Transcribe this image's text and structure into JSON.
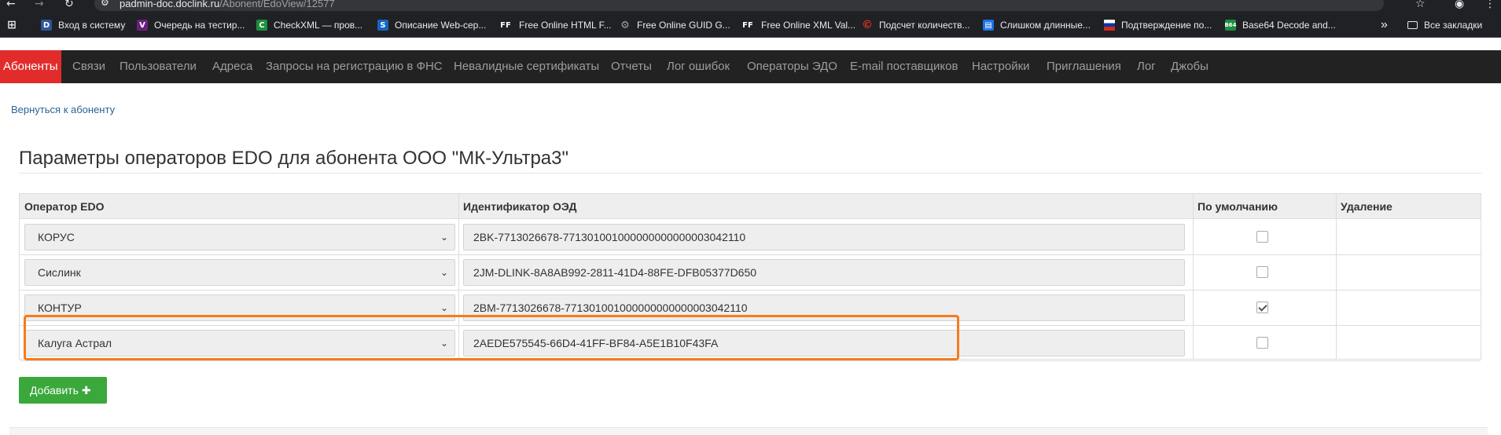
{
  "browser": {
    "url_host": "padmin-doc.doclink.ru",
    "url_path": "/Abonent/EdoView/12577",
    "bookmarks": [
      {
        "label": "Вход в систему",
        "icon": "doclink-icon",
        "color": "#2b5797",
        "glyph": "D"
      },
      {
        "label": "Очередь на тестир...",
        "icon": "visual-studio-icon",
        "color": "#68217a",
        "glyph": "V"
      },
      {
        "label": "CheckXML — пров...",
        "icon": "checkxml-icon",
        "color": "#1e8e3e",
        "glyph": "C"
      },
      {
        "label": "Описание Web-сер...",
        "icon": "web-service-icon",
        "color": "#1565c0",
        "glyph": "S"
      },
      {
        "label": "Free Online HTML F...",
        "icon": "freeformatter-icon",
        "color": "#202124",
        "glyph": "FF"
      },
      {
        "label": "Free Online GUID G...",
        "icon": "guid-gear-icon",
        "color": "#5f6368",
        "glyph": "⚙"
      },
      {
        "label": "Free Online XML Val...",
        "icon": "freeformatter-icon",
        "color": "#202124",
        "glyph": "FF"
      },
      {
        "label": "Подсчет количеств...",
        "icon": "copyright-icon",
        "color": "#d93025",
        "glyph": "©"
      },
      {
        "label": "Слишком длинные...",
        "icon": "page-icon",
        "color": "#1a73e8",
        "glyph": "▤"
      },
      {
        "label": "Подтверждение по...",
        "icon": "russia-flag-icon",
        "color": "#d52b1e",
        "glyph": ""
      },
      {
        "label": "Base64 Decode and...",
        "icon": "base64-icon",
        "color": "#1e8e3e",
        "glyph": "B"
      }
    ],
    "more_glyph": "»",
    "all_bookmarks": "Все закладки"
  },
  "nav": {
    "items": [
      "Абоненты",
      "Связи",
      "Пользователи",
      "Адреса",
      "Запросы на регистрацию в ФНС",
      "Невалидные сертификаты",
      "Отчеты",
      "Лог ошибок",
      "Операторы ЭДО",
      "E-mail поставщиков",
      "Настройки",
      "Приглашения",
      "Лог",
      "Джобы"
    ],
    "active_index": 0,
    "active_color": "#e22c2c"
  },
  "back_link": "Вернуться к абоненту",
  "page_title": "Параметры операторов EDO для абонента ООО \"МК-Ультра3\"",
  "table": {
    "headers": [
      "Оператор EDO",
      "Идентификатор ОЭД",
      "По умолчанию",
      "Удаление"
    ],
    "rows": [
      {
        "operator": "КОРУС",
        "id": "2BK-7713026678-771301001000000000000003042110",
        "default": false
      },
      {
        "operator": "Сислинк",
        "id": "2JM-DLINK-8A8AB992-2811-41D4-88FE-DFB05377D650",
        "default": false
      },
      {
        "operator": "КОНТУР",
        "id": "2BM-7713026678-771301001000000000000003042110",
        "default": true
      },
      {
        "operator": "Калуга Астрал",
        "id": "2AEDE575545-66D4-41FF-BF84-A5E1B10F43FA",
        "default": false
      }
    ]
  },
  "add_button": "Добавить",
  "highlight_color": "#f57c1f",
  "button_color": "#3aa83a"
}
